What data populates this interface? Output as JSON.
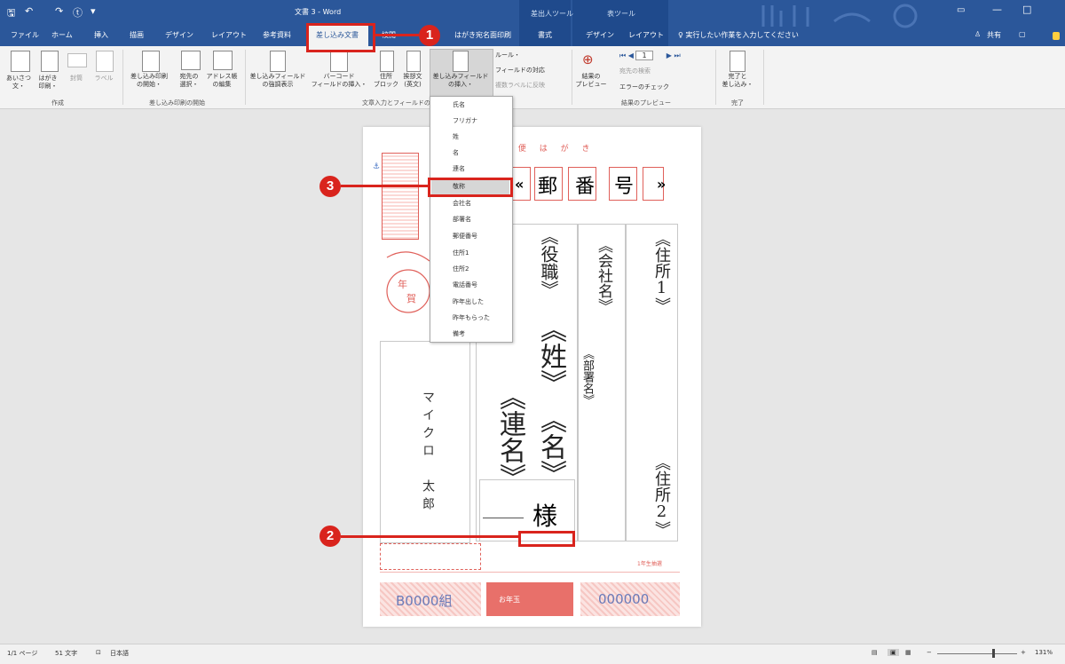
{
  "window": {
    "title": "文書 3 - Word",
    "ctx_mail": "差出人ツール",
    "ctx_table": "表ツール"
  },
  "quick_access": {
    "save": "🖫",
    "undo": "↶",
    "redo": "↷",
    "touch": "ⓣ",
    "more": "▾"
  },
  "tabs": [
    "ファイル",
    "ホーム",
    "挿入",
    "描画",
    "デザイン",
    "レイアウト",
    "参考資料",
    "差し込み文書",
    "校閲",
    "はがき宛名面印刷",
    "書式",
    "デザイン",
    "レイアウト"
  ],
  "tell_me": "♀ 実行したい作業を入力してください",
  "account": {
    "share": "共有"
  },
  "ribbon": {
    "b1": "あいさつ\n文・",
    "b2": "はがき\n印刷・",
    "b3": "封筒",
    "b4": "ラベル",
    "b5": "差し込み印刷\nの開始・",
    "b6": "宛先の\n選択・",
    "b7": "アドレス帳\nの編集",
    "b8": "差し込みフィールド\nの強調表示",
    "b9": "バーコード\nフィールドの挿入・",
    "b10": "住所\nブロック",
    "b11": "挨拶文\n(英文)",
    "b12": "差し込みフィールド\nの挿入・",
    "s1": "ルール・",
    "s2": "フィールドの対応",
    "s3": "複数ラベルに反映",
    "b13": "結果の\nプレビュー",
    "s4": "宛先の検索",
    "s5": "エラーのチェック",
    "b14": "完了と\n差し込み・",
    "g1": "作成",
    "g2": "差し込み印刷の開始",
    "g3": "文章入力とフィールドの挿入",
    "g4": "結果のプレビュー",
    "g5": "完了"
  },
  "postcard": {
    "header": "郵 便 は が き",
    "postal": "«郵番号»",
    "postal_chars": [
      "«",
      "郵",
      "番",
      "号",
      "»"
    ],
    "title_field": "《役職》",
    "company_field": "《会社名》",
    "dept_field": "《部署名》",
    "address1": "《住所1》",
    "address2": "《住所2》",
    "surname": "《姓》",
    "given": "《名》",
    "joint": "《連名》",
    "honorific": "様",
    "sender": "マイクロ　太郎",
    "lottery_note": "1年生抽選",
    "footer_left": "B0000組",
    "footer_right": "000000",
    "footer_center": "お年玉"
  },
  "dropdown": [
    "氏名",
    "フリガナ",
    "姓",
    "名",
    "連名",
    "敬称",
    "会社名",
    "部署名",
    "郵便番号",
    "住所1",
    "住所2",
    "電話番号",
    "昨年出した",
    "昨年もらった",
    "備考"
  ],
  "dropdown_selected": "敬称",
  "callouts": [
    "1",
    "2",
    "3"
  ],
  "status": {
    "page": "1/1 ページ",
    "words": "51 文字",
    "lang": "日本語",
    "zoom": "131%"
  }
}
